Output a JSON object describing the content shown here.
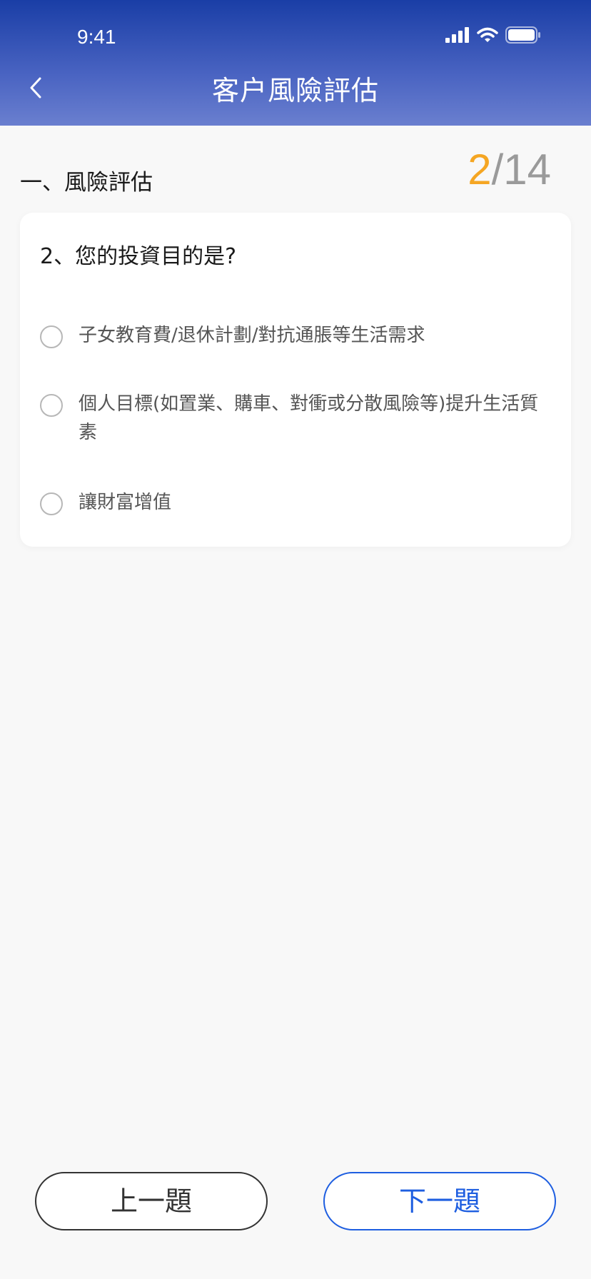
{
  "status_bar": {
    "time": "9:41",
    "icons": [
      "signal-icon",
      "wifi-icon",
      "battery-icon"
    ]
  },
  "header": {
    "title": "客户風險評估",
    "back_icon": "chevron-left-icon"
  },
  "section": {
    "title": "一、風險評估"
  },
  "progress": {
    "current": "2",
    "separator": "/",
    "total": "14"
  },
  "question": {
    "text": "2、您的投資目的是?",
    "options": [
      {
        "label": "子女教育費/退休計劃/對抗通脹等生活需求",
        "selected": false
      },
      {
        "label": "個人目標(如置業、購車、對衝或分散風險等)提升生活質素",
        "selected": false
      },
      {
        "label": "讓財富增值",
        "selected": false
      }
    ]
  },
  "buttons": {
    "prev": "上一題",
    "next": "下一題"
  },
  "colors": {
    "header_start": "#1a3ea6",
    "header_end": "#6a7fcf",
    "accent": "#f5a623",
    "primary": "#1e5ee0"
  }
}
